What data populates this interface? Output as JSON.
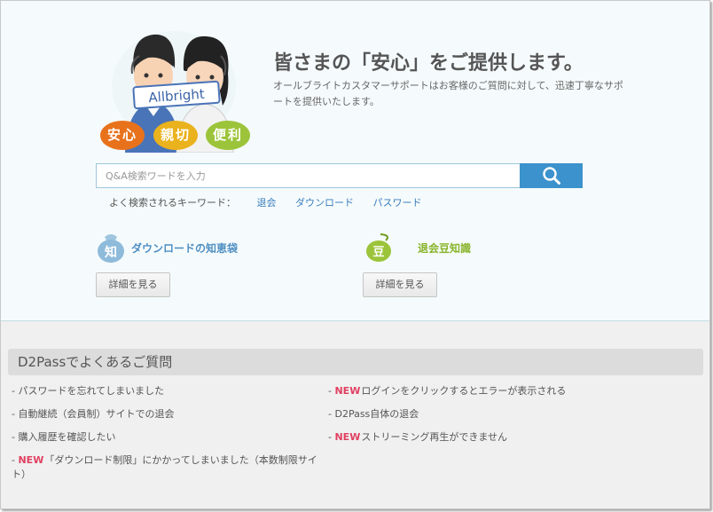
{
  "brand": {
    "logo_text": "Allbright",
    "badges": [
      "安心",
      "親切",
      "便利"
    ],
    "colors": {
      "accent": "#3c92cc",
      "orange": "#e8721c",
      "yellow": "#eab21c",
      "green": "#9cc43a",
      "new": "#e04060"
    }
  },
  "hero": {
    "title": "皆さまの「安心」をご提供します。",
    "description": "オールブライトカスタマーサポートはお客様のご質問に対して、迅速丁寧なサポートを提供いたします。"
  },
  "search": {
    "placeholder": "Q&A検索ワードを入力",
    "button_icon": "search-icon"
  },
  "keywords": {
    "label": "よく検索されるキーワード：",
    "items": [
      "退会",
      "ダウンロード",
      "パスワード"
    ]
  },
  "features": [
    {
      "icon_text": "知",
      "title": "ダウンロードの知恵袋",
      "button": "詳細を見る"
    },
    {
      "icon_text": "豆",
      "title": "退会豆知識",
      "button": "詳細を見る"
    }
  ],
  "faq": {
    "heading": "D2Passでよくあるご質問",
    "new_label": "NEW",
    "left": [
      {
        "prefix": "- ",
        "new": false,
        "text": "パスワードを忘れてしまいました"
      },
      {
        "prefix": "- ",
        "new": false,
        "text": "自動継続（会員制）サイトでの退会"
      },
      {
        "prefix": "- ",
        "new": false,
        "text": "購入履歴を確認したい"
      },
      {
        "prefix": "- ",
        "new": true,
        "text": "「ダウンロード制限」にかかってしまいました（本数制限サイト）"
      }
    ],
    "right": [
      {
        "prefix": "- ",
        "new": true,
        "text": "ログインをクリックするとエラーが表示される"
      },
      {
        "prefix": "- ",
        "new": false,
        "text": "D2Pass自体の退会"
      },
      {
        "prefix": "- ",
        "new": true,
        "text": "ストリーミング再生ができません"
      }
    ]
  }
}
